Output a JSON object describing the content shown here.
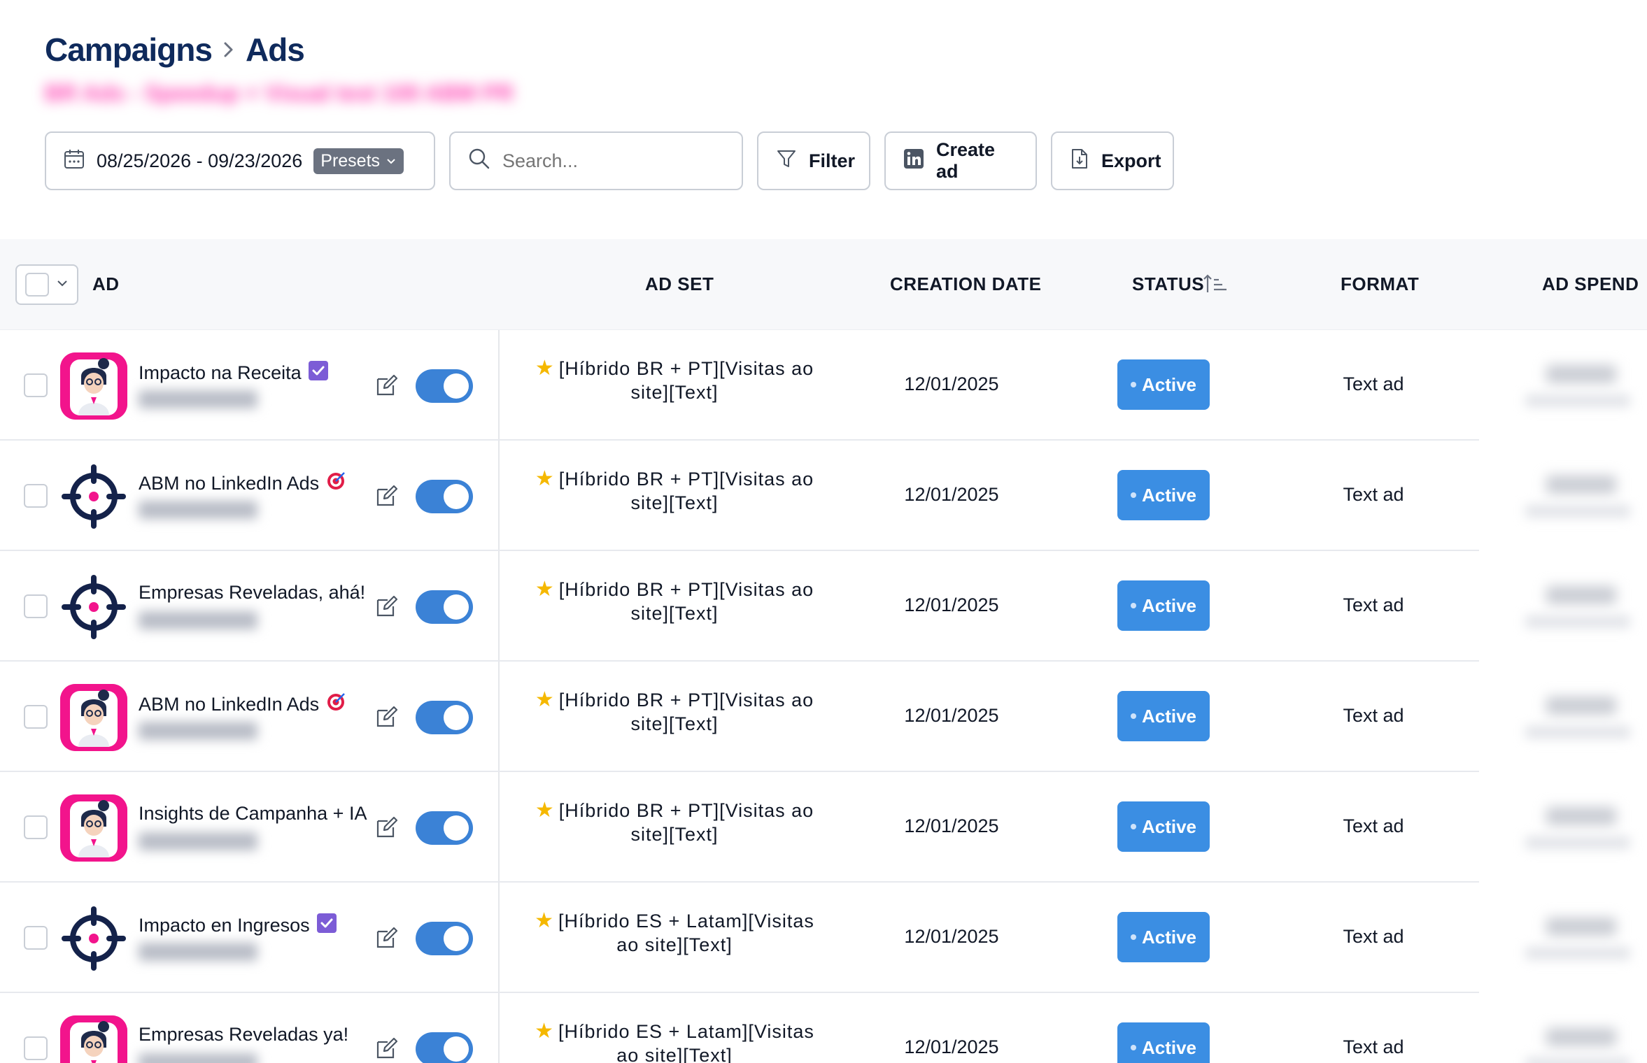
{
  "breadcrumb": {
    "parent": "Campaigns",
    "current": "Ads",
    "campaign_name_blurred": "BR Ads - Speedup + Visual test 100 ABM PR"
  },
  "toolbar": {
    "date_range": "08/25/2026 - 09/23/2026",
    "presets_label": "Presets",
    "search_placeholder": "Search...",
    "filter_label": "Filter",
    "create_label": "Create ad",
    "export_label": "Export"
  },
  "table": {
    "headers": {
      "ad": "AD",
      "ad_set": "AD SET",
      "creation_date": "CREATION DATE",
      "status": "STATUS",
      "format": "FORMAT",
      "ad_spend": "AD SPEND"
    },
    "rows": [
      {
        "name": "Impacto na Receita",
        "badge": "check",
        "avatar": "pink",
        "ad_set": "[Híbrido BR + PT][Visitas ao site][Text]",
        "date": "12/01/2025",
        "status": "Active",
        "format": "Text ad"
      },
      {
        "name": "ABM no LinkedIn Ads",
        "badge": "target",
        "avatar": "target",
        "ad_set": "[Híbrido BR + PT][Visitas ao site][Text]",
        "date": "12/01/2025",
        "status": "Active",
        "format": "Text ad"
      },
      {
        "name": "Empresas Reveladas, ahá!",
        "badge": "",
        "avatar": "target",
        "ad_set": "[Híbrido BR + PT][Visitas ao site][Text]",
        "date": "12/01/2025",
        "status": "Active",
        "format": "Text ad"
      },
      {
        "name": "ABM no LinkedIn Ads",
        "badge": "target",
        "avatar": "pink",
        "ad_set": "[Híbrido BR + PT][Visitas ao site][Text]",
        "date": "12/01/2025",
        "status": "Active",
        "format": "Text ad"
      },
      {
        "name": "Insights de Campanha + IA",
        "badge": "",
        "avatar": "pink",
        "ad_set": "[Híbrido BR + PT][Visitas ao site][Text]",
        "date": "12/01/2025",
        "status": "Active",
        "format": "Text ad"
      },
      {
        "name": "Impacto en Ingresos",
        "badge": "check",
        "avatar": "target",
        "ad_set": "[Híbrido ES + Latam][Visitas ao site][Text]",
        "date": "12/01/2025",
        "status": "Active",
        "format": "Text ad"
      },
      {
        "name": "Empresas Reveladas ya!",
        "badge": "",
        "avatar": "pink",
        "ad_set": "[Híbrido ES + Latam][Visitas ao site][Text]",
        "date": "12/01/2025",
        "status": "Active",
        "format": "Text ad"
      }
    ]
  },
  "colors": {
    "title": "#0f2a5c",
    "accent_pink": "#f2148c",
    "status_active": "#3b8ee3",
    "toggle_on": "#3b82d6"
  }
}
